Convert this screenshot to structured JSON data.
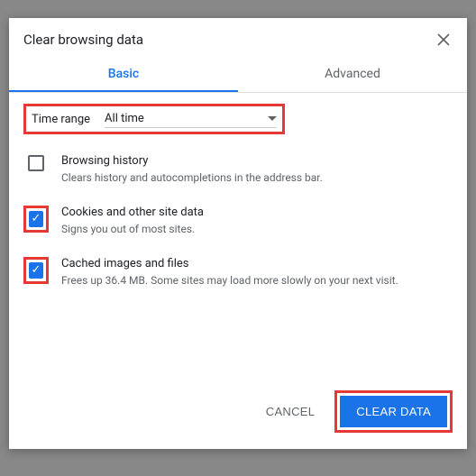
{
  "dialog": {
    "title": "Clear browsing data",
    "tabs": {
      "basic": "Basic",
      "advanced": "Advanced"
    },
    "time": {
      "label": "Time range",
      "value": "All time"
    },
    "options": [
      {
        "title": "Browsing history",
        "desc": "Clears history and autocompletions in the address bar.",
        "checked": false,
        "highlighted": false
      },
      {
        "title": "Cookies and other site data",
        "desc": "Signs you out of most sites.",
        "checked": true,
        "highlighted": true
      },
      {
        "title": "Cached images and files",
        "desc": "Frees up 36.4 MB. Some sites may load more slowly on your next visit.",
        "checked": true,
        "highlighted": true
      }
    ],
    "buttons": {
      "cancel": "CANCEL",
      "confirm": "CLEAR DATA"
    }
  }
}
